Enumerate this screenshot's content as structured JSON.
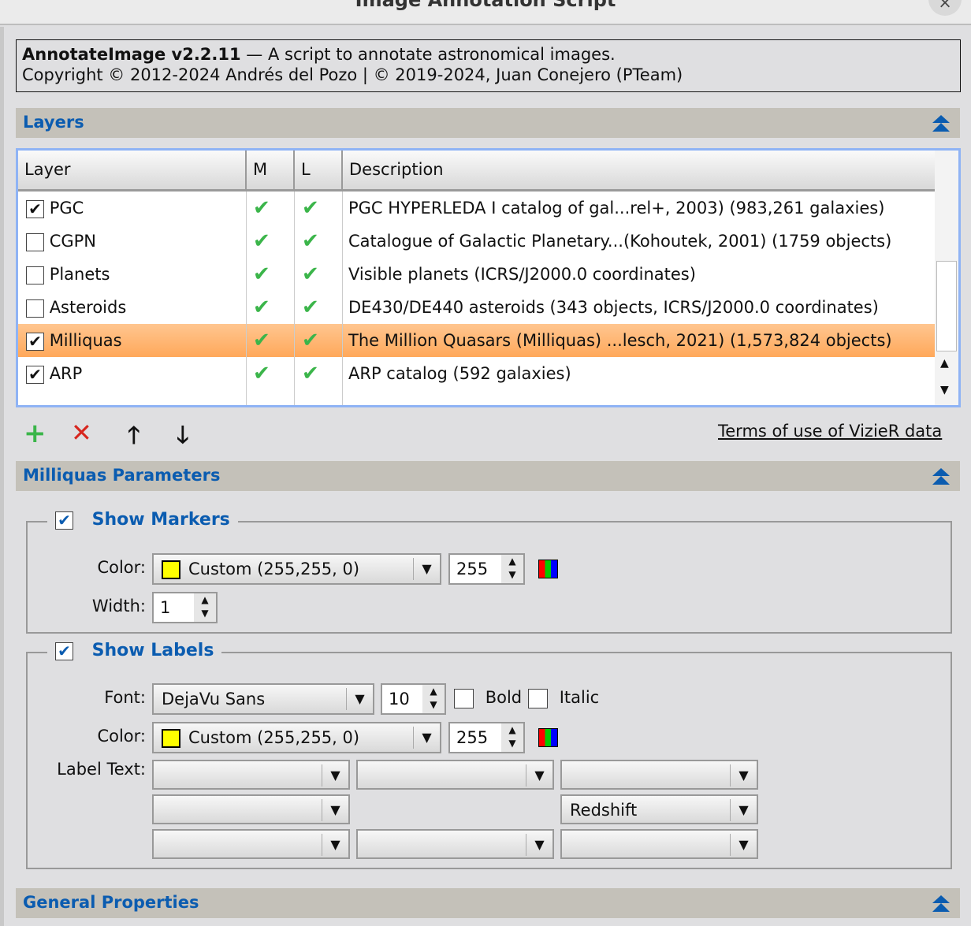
{
  "window": {
    "title": "Image Annotation Script",
    "close": "×"
  },
  "info": {
    "name": "AnnotateImage v2.2.11",
    "tagline": " — A script to annotate astronomical images.",
    "copyright": "Copyright © 2012-2024 Andrés del Pozo | © 2019-2024, Juan Conejero (PTeam)"
  },
  "layers": {
    "title": "Layers",
    "columns": [
      "Layer",
      "M",
      "L",
      "Description"
    ],
    "rows": [
      {
        "name": "PGC",
        "checked": true,
        "desc": "PGC HYPERLEDA I catalog of gal...rel+, 2003) (983,261 galaxies)"
      },
      {
        "name": "CGPN",
        "checked": false,
        "desc": "Catalogue of Galactic Planetary...(Kohoutek, 2001) (1759 objects)"
      },
      {
        "name": "Planets",
        "checked": false,
        "desc": "Visible planets (ICRS/J2000.0 coordinates)"
      },
      {
        "name": "Asteroids",
        "checked": false,
        "desc": "DE430/DE440 asteroids (343 objects, ICRS/J2000.0 coordinates)"
      },
      {
        "name": "Milliquas",
        "checked": true,
        "selected": true,
        "desc": "The Million Quasars (Milliquas) ...lesch, 2021) (1,573,824 objects)"
      },
      {
        "name": "ARP",
        "checked": true,
        "desc": "ARP catalog (592 galaxies)"
      }
    ],
    "check_glyph": "✔",
    "terms": "Terms of use of VizieR data"
  },
  "params": {
    "title": "Milliquas Parameters",
    "markers": {
      "title": "Show Markers",
      "color_label": "Color:",
      "color_value": "Custom (255,255,  0)",
      "alpha": "255",
      "width_label": "Width:",
      "width": "1"
    },
    "labels": {
      "title": "Show Labels",
      "font_label": "Font:",
      "font": "DejaVu Sans",
      "size": "10",
      "bold": "Bold",
      "italic": "Italic",
      "color_label": "Color:",
      "color_value": "Custom (255,255,  0)",
      "alpha": "255",
      "text_label": "Label Text:",
      "redshift": "Redshift"
    }
  },
  "general": {
    "title": "General Properties"
  },
  "colors": {
    "accent": "#0b5cb0",
    "selection": "#ffa85a",
    "check": "#3bb54a"
  }
}
